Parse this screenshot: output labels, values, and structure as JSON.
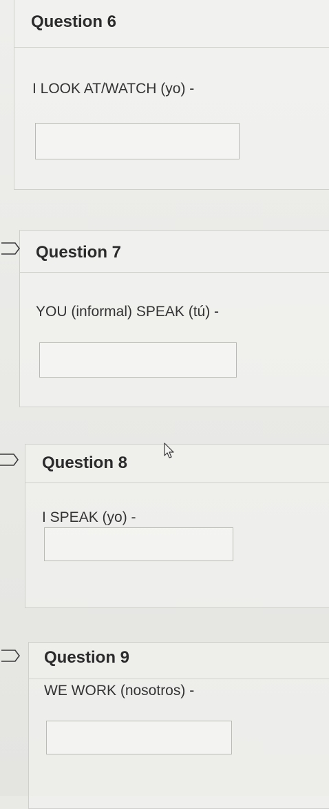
{
  "questions": [
    {
      "title": "Question 6",
      "prompt": "I LOOK AT/WATCH (yo) -",
      "answer": ""
    },
    {
      "title": "Question 7",
      "prompt": "YOU (informal) SPEAK (tú) -",
      "answer": ""
    },
    {
      "title": "Question 8",
      "prompt": "I SPEAK (yo) -",
      "answer": ""
    },
    {
      "title": "Question 9",
      "prompt": "WE WORK (nosotros) -",
      "answer": ""
    }
  ],
  "icons": {
    "flag": "flag-outline-icon",
    "cursor": "mouse-pointer-icon"
  }
}
